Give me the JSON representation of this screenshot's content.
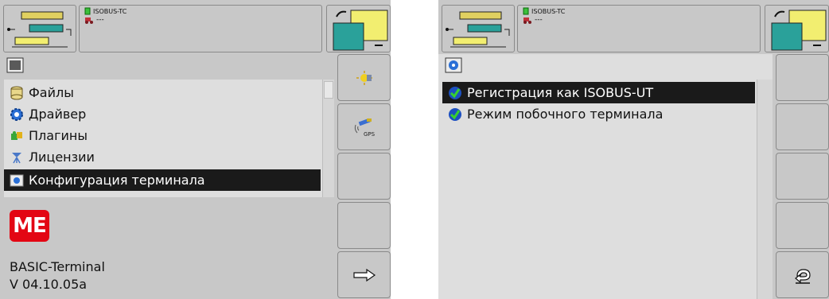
{
  "left": {
    "header": {
      "task_label": "ISOBUS-TC",
      "task_sub": "---"
    },
    "menu": {
      "items": [
        {
          "label": "Файлы",
          "icon": "database-icon",
          "selected": false
        },
        {
          "label": "Драйвер",
          "icon": "gear-icon",
          "selected": false
        },
        {
          "label": "Плагины",
          "icon": "puzzle-icon",
          "selected": false
        },
        {
          "label": "Лицензии",
          "icon": "license-icon",
          "selected": false
        },
        {
          "label": "Конфигурация терминала",
          "icon": "terminal-config-icon",
          "selected": true
        }
      ]
    },
    "info": {
      "logo_text": "ME",
      "product": "BASIC-Terminal",
      "version": "V 04.10.05a"
    },
    "softkeys": [
      "brightness-icon",
      "gps-icon",
      "",
      "",
      "arrow-right-icon"
    ]
  },
  "right": {
    "header": {
      "task_label": "ISOBUS-TC",
      "task_sub": "---"
    },
    "menu": {
      "items": [
        {
          "label": "Регистрация как ISOBUS-UT",
          "icon": "check-icon",
          "selected": true
        },
        {
          "label": "Режим побочного терминала",
          "icon": "check-icon",
          "selected": false
        }
      ]
    },
    "softkeys": [
      "",
      "",
      "",
      "",
      "back-icon"
    ]
  },
  "colors": {
    "panel": "#c8c8c8",
    "list_bg": "#dedede",
    "selection": "#1a1a1a",
    "brand": "#e30613"
  }
}
